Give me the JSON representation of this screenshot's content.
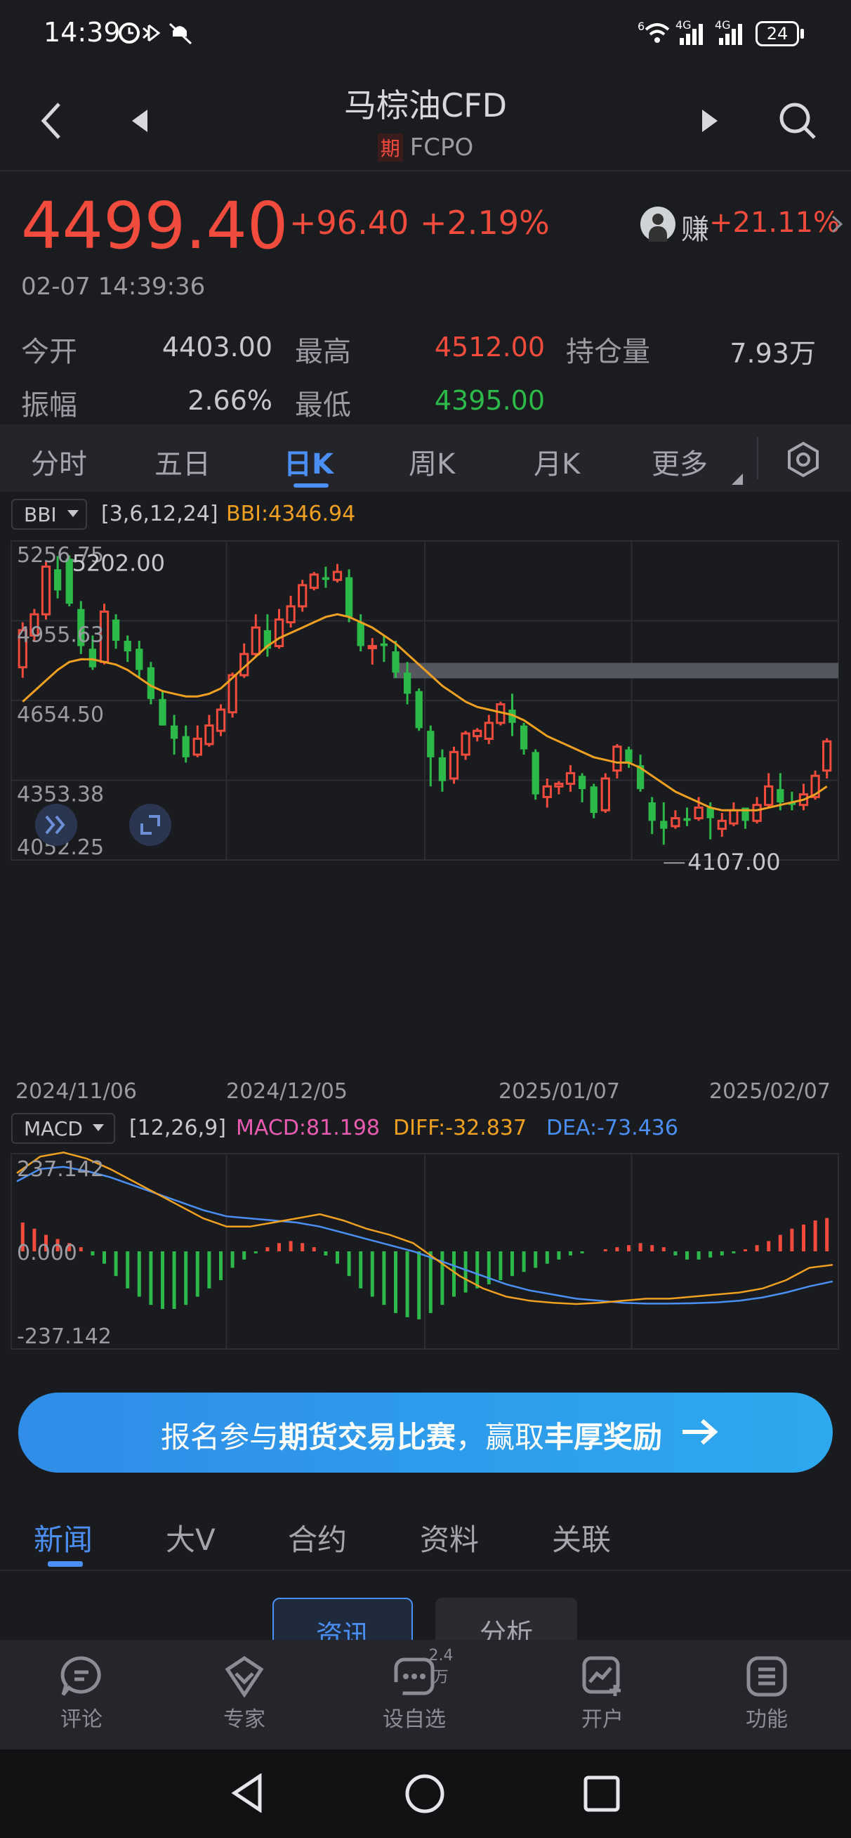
{
  "status": {
    "time": "14:39",
    "battery": "24",
    "net1": "4G",
    "net2": "4G",
    "wifi_badge": "6"
  },
  "header": {
    "title": "马棕油CFD",
    "badge": "期",
    "code": "FCPO"
  },
  "quote": {
    "price": "4499.40",
    "change": "+96.40",
    "change_pct": "+2.19%",
    "time": "02-07 14:39:36",
    "earn_label": "赚",
    "earn_pct": "+21.11%",
    "stats": [
      {
        "label": "今开",
        "value": "4403.00"
      },
      {
        "label": "最高",
        "value": "4512.00"
      },
      {
        "label": "持仓量",
        "value": "7.93万"
      },
      {
        "label": "振幅",
        "value": "2.66%"
      },
      {
        "label": "最低",
        "value": "4395.00"
      }
    ]
  },
  "tabs": [
    "分时",
    "五日",
    "日K",
    "周K",
    "月K",
    "更多"
  ],
  "active_tab": "日K",
  "indicator": {
    "name": "BBI",
    "params": "[3,6,12,24]",
    "value": "BBI:4346.94"
  },
  "macd": {
    "name": "MACD",
    "params": "[12,26,9]",
    "macd": "MACD:81.198",
    "diff": "DIFF:-32.837",
    "dea": "DEA:-73.436",
    "y_labels": [
      "237.142",
      "0.000",
      "-237.142"
    ]
  },
  "chart_data": {
    "type": "candlestick",
    "y_labels": [
      "5256.75",
      "4955.63",
      "4654.50",
      "4353.38",
      "4052.25"
    ],
    "x_labels": [
      "2024/11/06",
      "2024/12/05",
      "2025/01/07",
      "2025/02/07"
    ],
    "ylim": [
      4052.25,
      5256.75
    ],
    "high_label": "5202.00",
    "low_label": "4107.00",
    "candles": [
      [
        4780,
        4920,
        4740,
        4950
      ],
      [
        4900,
        4980,
        4880,
        5000
      ],
      [
        4980,
        5160,
        4960,
        5180
      ],
      [
        5150,
        5070,
        5040,
        5200
      ],
      [
        5190,
        5020,
        5010,
        5202
      ],
      [
        5000,
        4860,
        4830,
        5030
      ],
      [
        4850,
        4780,
        4770,
        4900
      ],
      [
        4800,
        4990,
        4790,
        5020
      ],
      [
        4960,
        4880,
        4850,
        4980
      ],
      [
        4880,
        4840,
        4800,
        4900
      ],
      [
        4850,
        4770,
        4740,
        4880
      ],
      [
        4780,
        4660,
        4640,
        4800
      ],
      [
        4660,
        4560,
        4560,
        4690
      ],
      [
        4560,
        4510,
        4450,
        4600
      ],
      [
        4520,
        4440,
        4420,
        4560
      ],
      [
        4450,
        4510,
        4440,
        4560
      ],
      [
        4490,
        4560,
        4480,
        4600
      ],
      [
        4540,
        4620,
        4520,
        4640
      ],
      [
        4610,
        4750,
        4590,
        4760
      ],
      [
        4750,
        4830,
        4740,
        4870
      ],
      [
        4830,
        4930,
        4820,
        4980
      ],
      [
        4920,
        4850,
        4820,
        4980
      ],
      [
        4860,
        4960,
        4850,
        5000
      ],
      [
        4950,
        5010,
        4930,
        5050
      ],
      [
        5010,
        5090,
        4990,
        5110
      ],
      [
        5080,
        5130,
        5070,
        5140
      ],
      [
        5120,
        5110,
        5080,
        5160
      ],
      [
        5110,
        5140,
        5100,
        5170
      ],
      [
        5120,
        4970,
        4950,
        5150
      ],
      [
        4950,
        4860,
        4840,
        4980
      ],
      [
        4860,
        4860,
        4790,
        4890
      ],
      [
        4870,
        4860,
        4800,
        4900
      ],
      [
        4840,
        4760,
        4740,
        4880
      ],
      [
        4760,
        4680,
        4640,
        4800
      ],
      [
        4690,
        4550,
        4540,
        4700
      ],
      [
        4540,
        4440,
        4330,
        4560
      ],
      [
        4440,
        4350,
        4310,
        4470
      ],
      [
        4360,
        4460,
        4340,
        4480
      ],
      [
        4450,
        4530,
        4430,
        4540
      ],
      [
        4520,
        4540,
        4500,
        4550
      ],
      [
        4510,
        4570,
        4490,
        4600
      ],
      [
        4570,
        4640,
        4560,
        4650
      ],
      [
        4620,
        4570,
        4520,
        4680
      ],
      [
        4560,
        4470,
        4450,
        4570
      ],
      [
        4460,
        4300,
        4280,
        4470
      ],
      [
        4290,
        4330,
        4250,
        4360
      ],
      [
        4330,
        4340,
        4300,
        4350
      ],
      [
        4340,
        4380,
        4310,
        4410
      ],
      [
        4370,
        4320,
        4270,
        4380
      ],
      [
        4330,
        4230,
        4210,
        4340
      ],
      [
        4240,
        4360,
        4230,
        4380
      ],
      [
        4390,
        4480,
        4360,
        4490
      ],
      [
        4470,
        4420,
        4400,
        4480
      ],
      [
        4410,
        4320,
        4310,
        4450
      ],
      [
        4270,
        4200,
        4150,
        4290
      ],
      [
        4200,
        4170,
        4110,
        4270
      ],
      [
        4180,
        4210,
        4170,
        4240
      ],
      [
        4210,
        4200,
        4180,
        4250
      ],
      [
        4210,
        4250,
        4200,
        4290
      ],
      [
        4250,
        4210,
        4130,
        4270
      ],
      [
        4170,
        4200,
        4140,
        4230
      ],
      [
        4190,
        4240,
        4180,
        4270
      ],
      [
        4250,
        4200,
        4170,
        4250
      ],
      [
        4200,
        4260,
        4190,
        4290
      ],
      [
        4260,
        4330,
        4250,
        4380
      ],
      [
        4320,
        4270,
        4240,
        4380
      ],
      [
        4270,
        4260,
        4240,
        4310
      ],
      [
        4260,
        4300,
        4240,
        4340
      ],
      [
        4290,
        4370,
        4280,
        4390
      ],
      [
        4390,
        4500,
        4360,
        4512
      ]
    ],
    "bbi_line": [
      4650,
      4690,
      4730,
      4770,
      4800,
      4810,
      4810,
      4800,
      4790,
      4770,
      4740,
      4710,
      4690,
      4680,
      4670,
      4670,
      4680,
      4700,
      4740,
      4780,
      4820,
      4860,
      4890,
      4910,
      4930,
      4950,
      4970,
      4980,
      4970,
      4950,
      4930,
      4900,
      4870,
      4830,
      4790,
      4750,
      4710,
      4680,
      4650,
      4630,
      4620,
      4610,
      4600,
      4580,
      4550,
      4520,
      4500,
      4480,
      4460,
      4440,
      4430,
      4420,
      4420,
      4400,
      4370,
      4340,
      4310,
      4290,
      4270,
      4250,
      4240,
      4240,
      4240,
      4240,
      4250,
      4260,
      4270,
      4280,
      4300,
      4330
    ]
  },
  "macd_data": {
    "histogram": [
      70,
      55,
      40,
      30,
      20,
      10,
      -10,
      -30,
      -60,
      -90,
      -110,
      -130,
      -140,
      -140,
      -130,
      -110,
      -90,
      -70,
      -40,
      -20,
      -5,
      10,
      20,
      25,
      20,
      10,
      -10,
      -30,
      -60,
      -90,
      -110,
      -130,
      -150,
      -160,
      -165,
      -150,
      -130,
      -110,
      -100,
      -90,
      -80,
      -70,
      -60,
      -50,
      -40,
      -30,
      -20,
      -10,
      -5,
      0,
      5,
      10,
      15,
      20,
      15,
      10,
      -10,
      -20,
      -20,
      -15,
      -10,
      -5,
      5,
      15,
      25,
      40,
      55,
      65,
      75,
      81
    ],
    "diff": [
      190,
      230,
      240,
      225,
      200,
      170,
      140,
      110,
      80,
      60,
      60,
      70,
      80,
      90,
      75,
      55,
      40,
      20,
      -20,
      -60,
      -90,
      -110,
      -120,
      -125,
      -128,
      -125,
      -120,
      -115,
      -115,
      -110,
      -105,
      -100,
      -90,
      -70,
      -40,
      -33
    ],
    "dea": [
      170,
      200,
      205,
      195,
      180,
      160,
      140,
      120,
      100,
      85,
      80,
      75,
      70,
      60,
      45,
      30,
      15,
      0,
      -20,
      -40,
      -60,
      -80,
      -95,
      -105,
      -115,
      -120,
      -125,
      -127,
      -127,
      -126,
      -124,
      -120,
      -112,
      -100,
      -85,
      -73
    ]
  },
  "banner": {
    "prefix": "报名参与",
    "bold1": "期货交易比赛",
    "mid": "，赢取",
    "bold2": "丰厚奖励"
  },
  "news_tabs": [
    "新闻",
    "大V",
    "合约",
    "资料",
    "关联"
  ],
  "news_active": "新闻",
  "sub_tabs": [
    "资讯",
    "分析"
  ],
  "bottom_nav": [
    {
      "label": "评论",
      "icon": "comment-icon"
    },
    {
      "label": "专家",
      "icon": "expert-icon"
    },
    {
      "label": "设自选",
      "icon": "watchlist-icon",
      "badge": "2.4万"
    },
    {
      "label": "开户",
      "icon": "open-account-icon"
    },
    {
      "label": "功能",
      "icon": "menu-icon"
    }
  ],
  "colors": {
    "up": "#f04b3c",
    "down": "#2db84a",
    "accent": "#4b8ff5",
    "bbi": "#f0a020",
    "diff": "#f0a020",
    "dea": "#4b8ff5",
    "macd_label": "#e85bb0"
  }
}
